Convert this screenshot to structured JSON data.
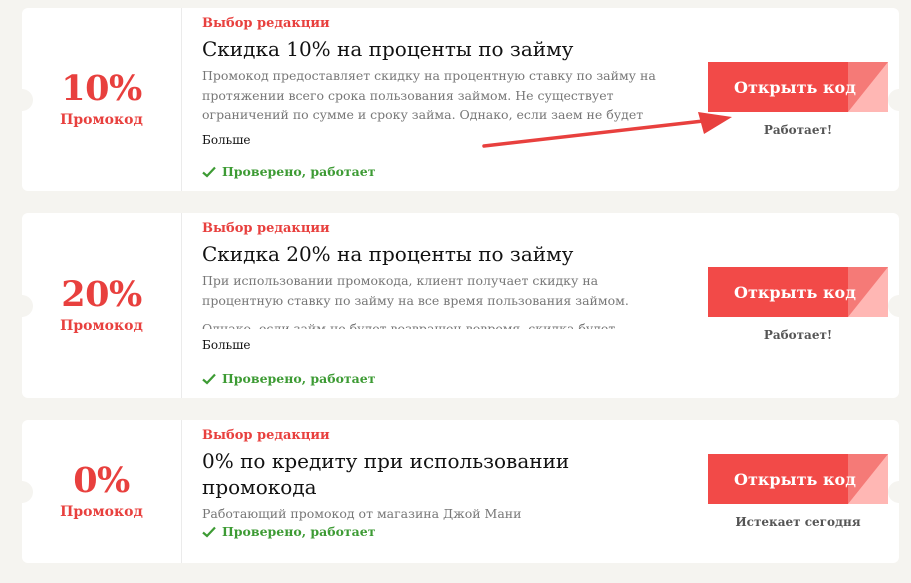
{
  "coupons": [
    {
      "percent": "10%",
      "percent_label": "Промокод",
      "editor_label": "Выбор редакции",
      "title": "Скидка 10% на проценты по займу",
      "description": "Промокод предоставляет скидку на процентную ставку по займу на протяжении всего срока пользования займом. Не существует ограничений по сумме и сроку займа. Однако, если заем не будет возвращен вовремя, скидк…",
      "more_label": "Больше",
      "verified_label": "Проверено, работает",
      "button_label": "Открыть код",
      "status": "Работает!"
    },
    {
      "percent": "20%",
      "percent_label": "Промокод",
      "editor_label": "Выбор редакции",
      "title": "Скидка 20% на проценты по займу",
      "description": "При использовании промокода, клиент получает скидку на процентную ставку по займу на все время пользования займом.",
      "description_2": "Однако, если займ не будет возвращен вовремя, скидка будет отменена, и",
      "more_label": "Больше",
      "verified_label": "Проверено, работает",
      "button_label": "Открыть код",
      "status": "Работает!"
    },
    {
      "percent": "0%",
      "percent_label": "Промокод",
      "editor_label": "Выбор редакции",
      "title": "0% по кредиту при использовании промокода",
      "description": "Работающий промокод от магазина Джой Мани",
      "verified_label": "Проверено, работает",
      "button_label": "Открыть код",
      "status": "Истекает сегодня"
    }
  ],
  "colors": {
    "accent": "#e8403e",
    "button": "#f24a48",
    "verified": "#3d9b34",
    "arrow": "#e8403e"
  },
  "icons": {
    "verified": "check-icon",
    "annotation": "red-arrow"
  }
}
